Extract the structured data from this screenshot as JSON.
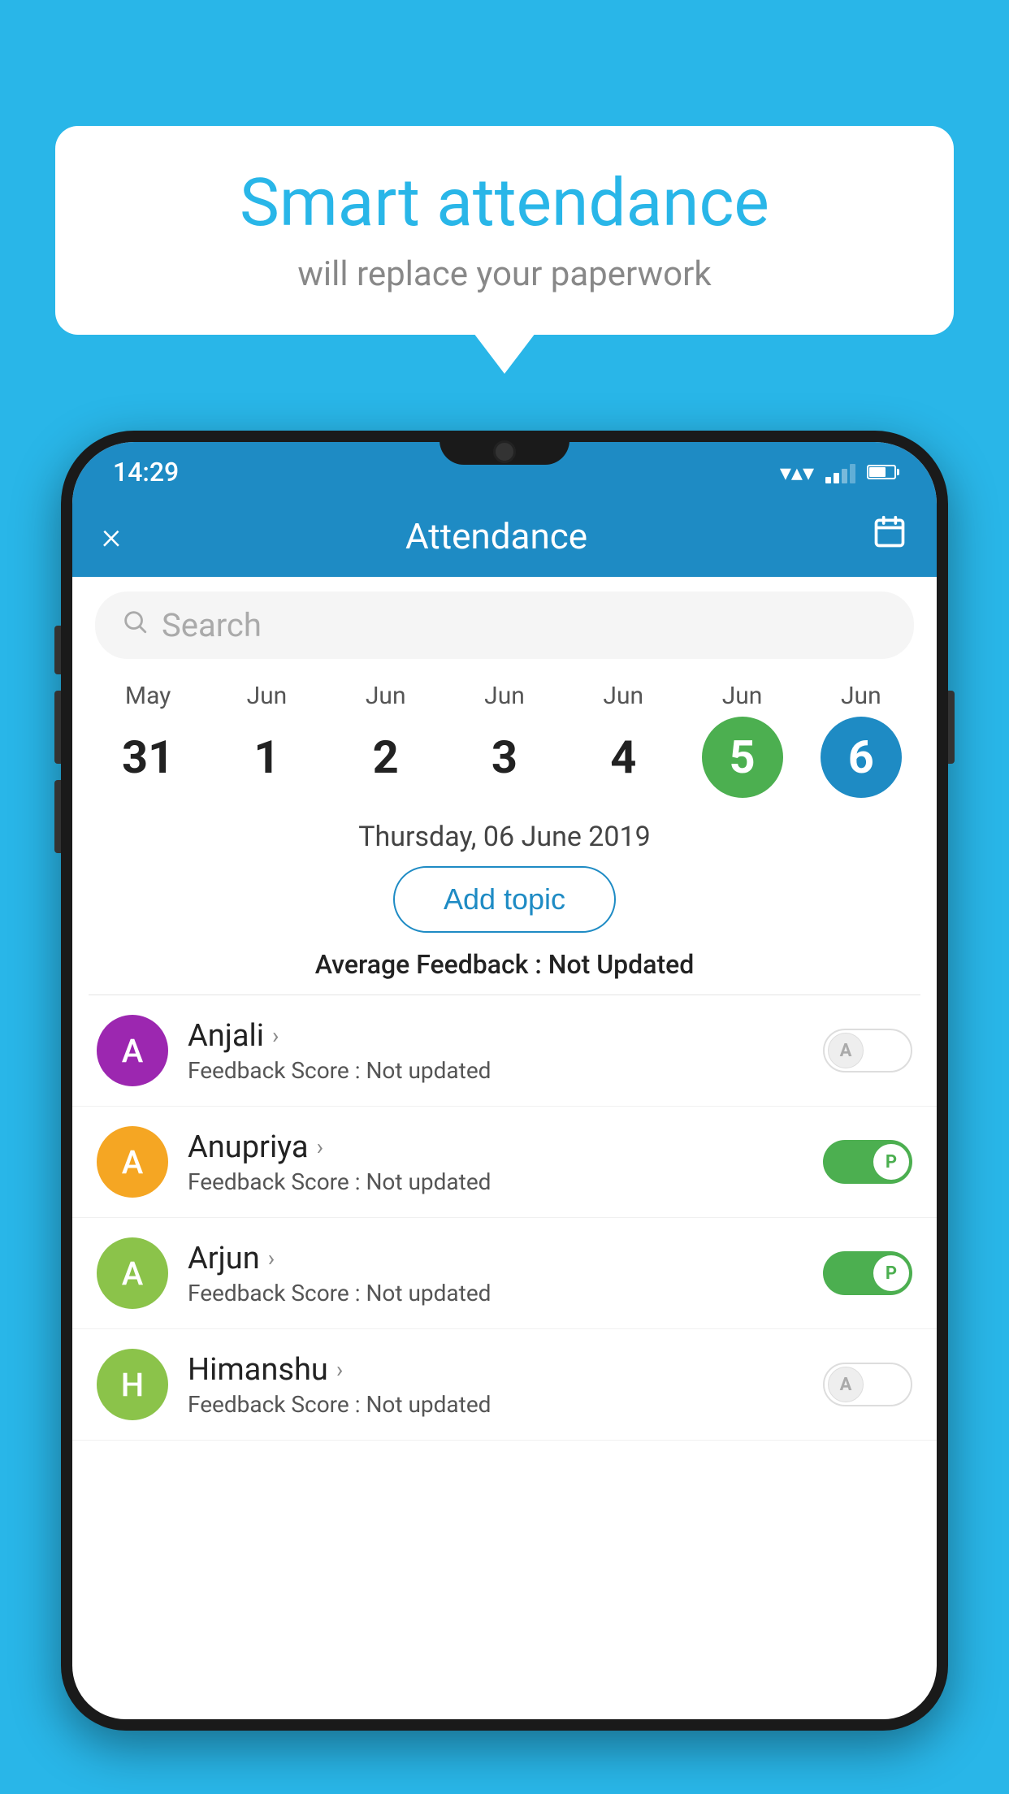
{
  "background_color": "#29b6e8",
  "bubble": {
    "title": "Smart attendance",
    "subtitle": "will replace your paperwork"
  },
  "status_bar": {
    "time": "14:29",
    "wifi": "wifi",
    "signal": "signal",
    "battery": "battery"
  },
  "app_bar": {
    "title": "Attendance",
    "close_label": "×",
    "calendar_label": "📅"
  },
  "search": {
    "placeholder": "Search"
  },
  "calendar": {
    "days": [
      {
        "month": "May",
        "date": "31",
        "active": ""
      },
      {
        "month": "Jun",
        "date": "1",
        "active": ""
      },
      {
        "month": "Jun",
        "date": "2",
        "active": ""
      },
      {
        "month": "Jun",
        "date": "3",
        "active": ""
      },
      {
        "month": "Jun",
        "date": "4",
        "active": ""
      },
      {
        "month": "Jun",
        "date": "5",
        "active": "green"
      },
      {
        "month": "Jun",
        "date": "6",
        "active": "blue"
      }
    ]
  },
  "selected_date": "Thursday, 06 June 2019",
  "add_topic_label": "Add topic",
  "avg_feedback_label": "Average Feedback :",
  "avg_feedback_value": "Not Updated",
  "students": [
    {
      "name": "Anjali",
      "avatar_letter": "A",
      "avatar_color": "#9c27b0",
      "feedback_label": "Feedback Score :",
      "feedback_value": "Not updated",
      "toggle": "off",
      "toggle_letter": "A"
    },
    {
      "name": "Anupriya",
      "avatar_letter": "A",
      "avatar_color": "#f5a623",
      "feedback_label": "Feedback Score :",
      "feedback_value": "Not updated",
      "toggle": "on",
      "toggle_letter": "P"
    },
    {
      "name": "Arjun",
      "avatar_letter": "A",
      "avatar_color": "#8bc34a",
      "feedback_label": "Feedback Score :",
      "feedback_value": "Not updated",
      "toggle": "on",
      "toggle_letter": "P"
    },
    {
      "name": "Himanshu",
      "avatar_letter": "H",
      "avatar_color": "#8bc34a",
      "feedback_label": "Feedback Score :",
      "feedback_value": "Not updated",
      "toggle": "off",
      "toggle_letter": "A"
    }
  ]
}
